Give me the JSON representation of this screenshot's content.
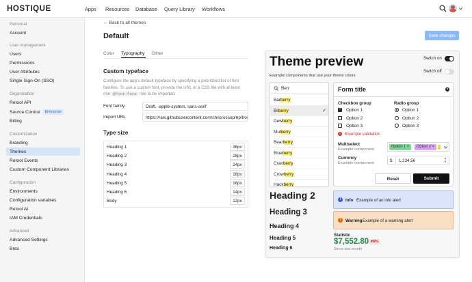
{
  "topbar": {
    "logo": "HOSTIQUE",
    "nav": [
      "Apps",
      "Resources",
      "Database",
      "Query Library",
      "Workflows"
    ]
  },
  "sidebar": {
    "personal_header": "Personal",
    "account": "Account",
    "user_mgmt_header": "User management",
    "users": "Users",
    "permissions": "Permissions",
    "user_attributes": "User Attributes",
    "sso": "Single Sign-On (SSO)",
    "org_header": "Organization",
    "retool_api": "Retool API",
    "source_control": "Source Control",
    "enterprise_badge": "Enterprise",
    "billing": "Billing",
    "custom_header": "Customization",
    "branding": "Branding",
    "themes": "Themes",
    "retool_events": "Retool Events",
    "ccl": "Custom Component Libraries",
    "config_header": "Configuration",
    "environments": "Environments",
    "config_vars": "Configuration variables",
    "retool_ai": "Retool AI",
    "iam": "IAM Credentials",
    "advanced_header": "Advanced",
    "advanced_settings": "Advanced Settings",
    "beta": "Beta"
  },
  "main": {
    "back": "Back to all themes",
    "title": "Default",
    "save": "Save changes",
    "tabs": [
      "Color",
      "Typography",
      "Other"
    ],
    "typeface_title": "Custom typeface",
    "typeface_desc1": "Configure the app's default typeface by specifying a prioritized list of font",
    "typeface_desc2": "families. To use a custom font, provide the URL of a CSS file with at least",
    "typeface_desc3_a": "one",
    "typeface_desc3_code": "@font-face",
    "typeface_desc3_b": "rule to be imported.",
    "font_family_label": "Font family",
    "font_family_value": "Draft, -apple-system, sans-serif",
    "import_url_label": "Import URL",
    "import_url_value": "https://raw.githubusercontent.com/chrisrossopmp/hosti",
    "type_size_title": "Type size",
    "type_sizes": [
      {
        "label": "Heading 1",
        "value": "36px"
      },
      {
        "label": "Heading 2",
        "value": "28px"
      },
      {
        "label": "Heading 3",
        "value": "24px"
      },
      {
        "label": "Heading 4",
        "value": "18px"
      },
      {
        "label": "Heading 5",
        "value": "16px"
      },
      {
        "label": "Heading 6",
        "value": "14px"
      },
      {
        "label": "Body",
        "value": "12px"
      }
    ]
  },
  "preview": {
    "title": "Theme preview",
    "subtitle": "Example components that use your theme colors",
    "switch_on": "Switch on",
    "switch_off": "Switch off",
    "search": "Berr",
    "list": [
      {
        "pre": "Bar",
        "hl": "berry",
        "post": ""
      },
      {
        "pre": "Bil",
        "hl": "berry",
        "post": ""
      },
      {
        "pre": "Dew",
        "hl": "berry",
        "post": ""
      },
      {
        "pre": "Mul",
        "hl": "berry",
        "post": ""
      },
      {
        "pre": "Bear",
        "hl": "berry",
        "post": ""
      },
      {
        "pre": "Blue",
        "hl": "berry",
        "post": ""
      },
      {
        "pre": "Cran",
        "hl": "berry",
        "post": ""
      },
      {
        "pre": "Crow",
        "hl": "berry",
        "post": ""
      },
      {
        "pre": "Hack",
        "hl": "berry",
        "post": ""
      }
    ],
    "headings": [
      "Heading 2",
      "Heading 3",
      "Heading 4",
      "Heading 5",
      "Heading 6"
    ],
    "form_title": "Form title",
    "checkbox_group": "Checkbox group",
    "radio_group": "Radio group",
    "checkbox_options": [
      "Option 1",
      "Option 2",
      "Option 3"
    ],
    "radio_options": [
      "Option 1",
      "Option 2",
      "Option 3"
    ],
    "validation": "Example validation",
    "multiselect_label": "Multiselect",
    "multiselect_sub": "Example component",
    "chip1": "Option 1",
    "chip2": "Option 2",
    "currency_label": "Currency",
    "currency_sub": "Example component",
    "currency_symbol": "$",
    "currency_value": "1,234.56",
    "reset": "Reset",
    "submit": "Submit",
    "info_bold": "Info",
    "info_text": "Example of an info alert",
    "warn_bold": "Warning",
    "warn_text": "Example of a warning alert",
    "stat_label": "Statistic",
    "stat_value": "$7,552.80",
    "stat_delta": "8%",
    "stat_caption": "Since last month"
  },
  "colors": {
    "accent": "#4c8ef0",
    "active_nav": "#d4e5f7",
    "info_bg": "#dbe4fb",
    "warn_bg": "#f8dfc4",
    "stat_green": "#1a8a4a",
    "error": "#d0302f"
  }
}
